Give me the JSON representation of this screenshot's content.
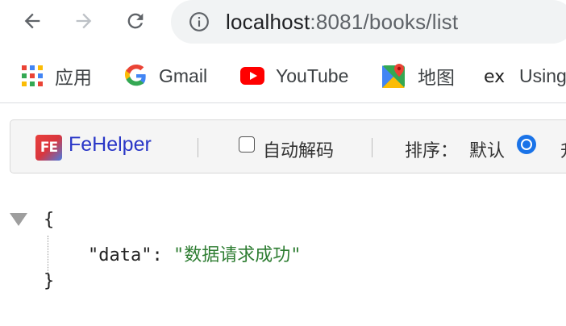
{
  "nav": {
    "back_icon": "arrow-left-icon",
    "forward_icon": "arrow-right-icon",
    "reload_icon": "reload-icon",
    "url_host": "localhost",
    "url_rest": ":8081/books/list"
  },
  "bookmarks": [
    {
      "label": "应用",
      "icon": "apps-grid-icon"
    },
    {
      "label": "Gmail",
      "icon": "google-g-icon"
    },
    {
      "label": "YouTube",
      "icon": "youtube-icon"
    },
    {
      "label": "地图",
      "icon": "maps-icon"
    },
    {
      "label": "Using",
      "icon": "ex-icon"
    }
  ],
  "fehelper": {
    "logo_text": "FE",
    "title": "FeHelper",
    "auto_decode_label": "自动解码",
    "auto_decode_checked": false,
    "sort_label": "排序：",
    "sort_default_label": "默认",
    "sort_default_selected": true,
    "next_option_partial": "升"
  },
  "json_view": {
    "open_brace": "{",
    "close_brace": "}",
    "key": "\"data\"",
    "colon": ":",
    "value": "\"数据请求成功\""
  },
  "colors": {
    "accent_blue": "#1a73e8",
    "fehelper_title": "#2a37c7",
    "json_string": "#2e7d32",
    "omnibox_bg": "#f1f3f4"
  }
}
